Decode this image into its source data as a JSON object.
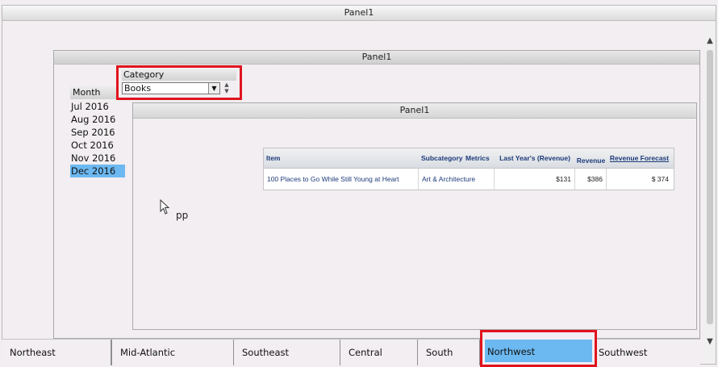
{
  "outer_panel": {
    "title": "Panel1"
  },
  "inner_panel": {
    "title": "Panel1"
  },
  "grid_panel": {
    "title": "Panel1"
  },
  "month_selector": {
    "header": "Month",
    "items": [
      "Jul 2016",
      "Aug 2016",
      "Sep 2016",
      "Oct 2016",
      "Nov 2016",
      "Dec 2016"
    ],
    "selected": "Dec 2016"
  },
  "category_selector": {
    "label": "Category",
    "value": "Books"
  },
  "grid": {
    "headers": {
      "item": "Item",
      "subcategory": "Subcategory",
      "metrics": "Metrics",
      "last_year": "Last Year's (Revenue)",
      "revenue": "Revenue",
      "forecast": "Revenue Forecast"
    },
    "rows": [
      {
        "item": "100 Places to Go While Still Young at Heart",
        "subcategory": "Art & Architecture",
        "last_year": "$131",
        "revenue": "$386",
        "forecast": "$ 374"
      }
    ]
  },
  "canvas_text": "pp",
  "region_tabs": {
    "items": [
      "Northeast",
      "Mid-Atlantic",
      "Southeast",
      "Central",
      "South",
      "Northwest",
      "Southwest"
    ],
    "selected": "Northwest"
  },
  "colors": {
    "selection": "#6cb8f0",
    "highlight_border": "#e0141e",
    "header_text": "#1d3b7a"
  }
}
